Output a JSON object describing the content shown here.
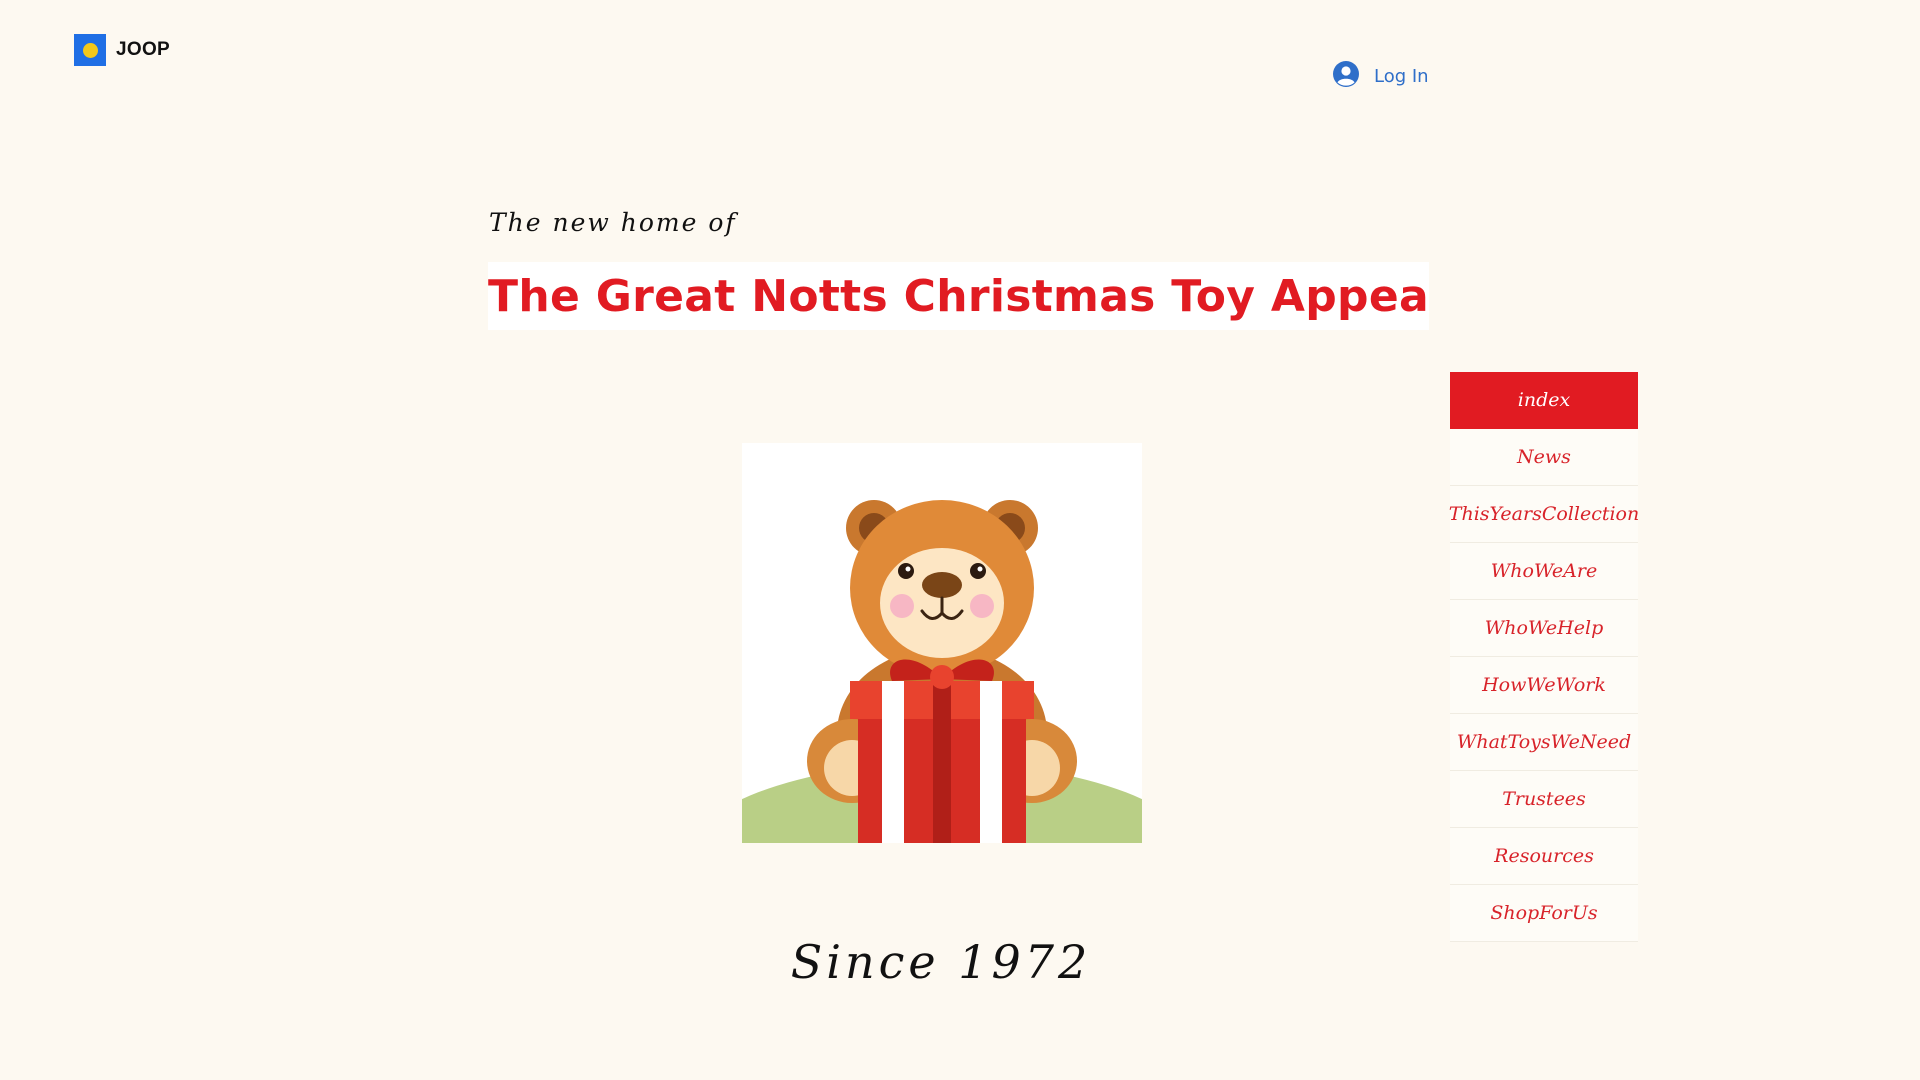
{
  "brand": {
    "name": "JOOP",
    "colors": {
      "mark_bg": "#1f6fe5",
      "mark_dot": "#f3c81a"
    }
  },
  "header": {
    "login_label": "Log In",
    "login_icon": "user-avatar-icon"
  },
  "hero": {
    "tagline": "The new home of",
    "title": "The Great Notts Christmas Toy Appeal",
    "image_subject": "teddy-bear-with-gift-icon",
    "since": "Since 1972"
  },
  "nav": {
    "items": [
      {
        "label": "index",
        "active": true
      },
      {
        "label": "News"
      },
      {
        "label": "ThisYearsCollection"
      },
      {
        "label": "WhoWeAre"
      },
      {
        "label": "WhoWeHelp"
      },
      {
        "label": "HowWeWork"
      },
      {
        "label": "WhatToysWeNeed"
      },
      {
        "label": "Trustees"
      },
      {
        "label": "Resources"
      },
      {
        "label": "ShopForUs"
      }
    ]
  },
  "colors": {
    "accent": "#e11b22",
    "link": "#2f6fc9",
    "background": "#fdf9f1"
  }
}
